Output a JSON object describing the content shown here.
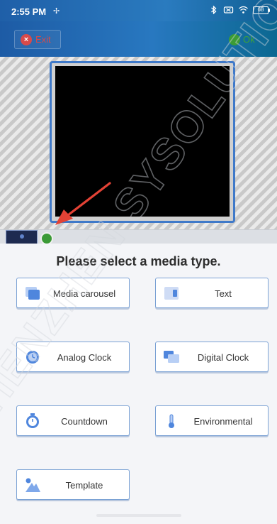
{
  "status": {
    "time": "2:55 PM",
    "battery": "68"
  },
  "toolbar": {
    "exit_label": "Exit",
    "ok_label": "Ok"
  },
  "sheet": {
    "title": "Please select a media type.",
    "items": [
      {
        "label": "Media carousel",
        "icon": "media-carousel-icon"
      },
      {
        "label": "Text",
        "icon": "text-icon"
      },
      {
        "label": "Analog Clock",
        "icon": "analog-clock-icon"
      },
      {
        "label": "Digital Clock",
        "icon": "digital-clock-icon"
      },
      {
        "label": "Countdown",
        "icon": "countdown-icon"
      },
      {
        "label": "Environmental",
        "icon": "environmental-icon"
      },
      {
        "label": "Template",
        "icon": "template-icon"
      }
    ]
  },
  "watermark": "SHENZHEN SYSOLUTION",
  "colors": {
    "accent": "#3f79c9",
    "exit": "#d84a4a",
    "ok": "#3c9c34"
  }
}
